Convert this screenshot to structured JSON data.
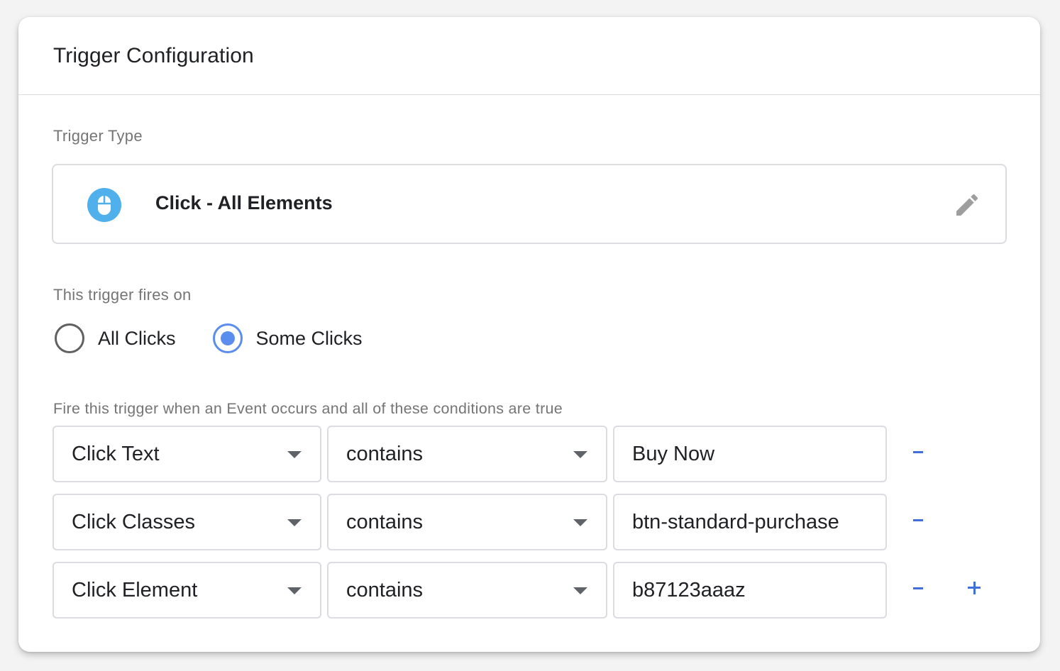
{
  "card": {
    "title": "Trigger Configuration"
  },
  "trigger_type": {
    "label": "Trigger Type",
    "name": "Click - All Elements",
    "icon": "mouse-icon",
    "icon_color": "#4fb0ec"
  },
  "fires_on": {
    "label": "This trigger fires on",
    "options": [
      {
        "label": "All Clicks",
        "selected": false
      },
      {
        "label": "Some Clicks",
        "selected": true
      }
    ]
  },
  "conditions": {
    "label": "Fire this trigger when an Event occurs and all of these conditions are true",
    "rows": [
      {
        "variable": "Click Text",
        "operator": "contains",
        "value": "Buy Now"
      },
      {
        "variable": "Click Classes",
        "operator": "contains",
        "value": "btn-standard-purchase"
      },
      {
        "variable": "Click Element",
        "operator": "contains",
        "value": "b87123aaaz"
      }
    ],
    "remove_icon": "minus-icon",
    "add_icon": "plus-icon"
  },
  "colors": {
    "accent": "#5b8def",
    "action_blue": "#3f6fd8",
    "text_primary": "#202124",
    "text_secondary": "#757575",
    "border": "#dadce0"
  }
}
